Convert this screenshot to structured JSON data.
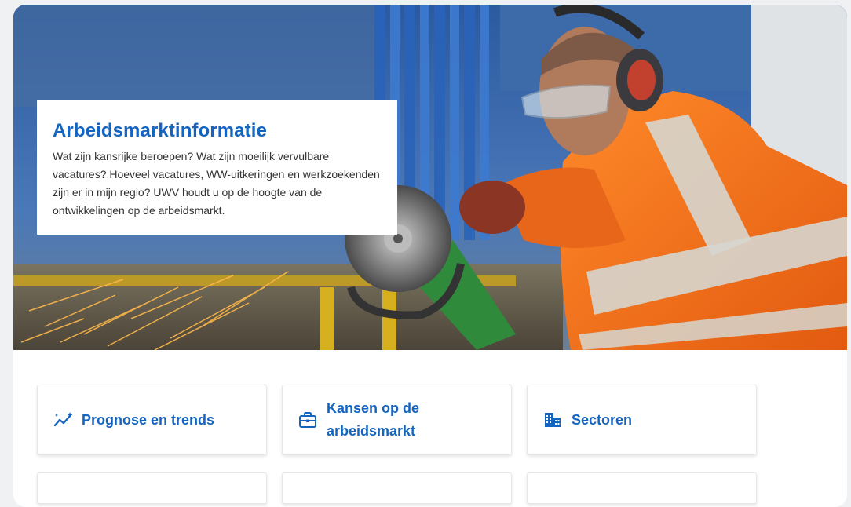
{
  "hero": {
    "title": "Arbeidsmarktinformatie",
    "description": "Wat zijn kansrijke beroepen? Wat zijn moeilijk vervulbare vacatures? Hoeveel vacatures, WW-uitkeringen en werkzoekenden zijn er in mijn regio? UWV houdt u op de hoogte van de ontwikkelingen op de arbeidsmarkt."
  },
  "tiles": [
    {
      "label": "Prognose en trends",
      "icon": "trend-sparkle-icon"
    },
    {
      "label": "Kansen op de arbeidsmarkt",
      "icon": "briefcase-icon"
    },
    {
      "label": "Sectoren",
      "icon": "buildings-icon"
    }
  ],
  "colors": {
    "accent": "#1565c0",
    "text": "#333333",
    "card": "#ffffff",
    "page": "#f0f1f3"
  }
}
